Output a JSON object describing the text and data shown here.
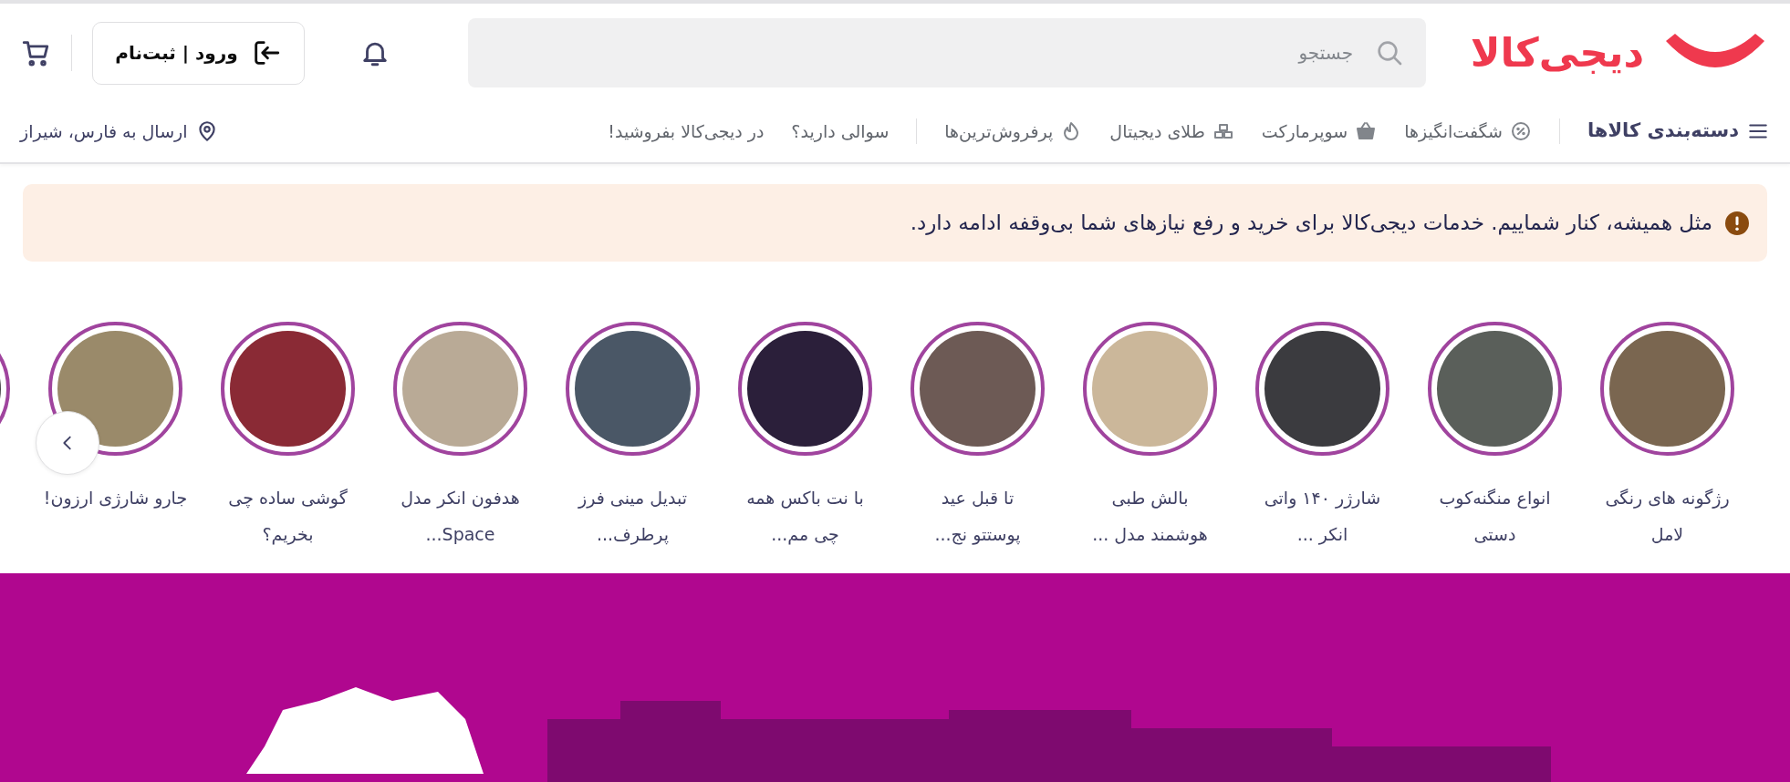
{
  "header": {
    "logo_text": "دیجی‌کالا",
    "search": {
      "placeholder": "جستجو"
    },
    "login_button": "ورود | ثبت‌نام"
  },
  "nav": {
    "categories": "دسته‌بندی کالاها",
    "items": [
      {
        "kind": "percent",
        "label": "شگفت‌انگیزها"
      },
      {
        "kind": "basket",
        "label": "سوپرمارکت"
      },
      {
        "kind": "gold",
        "label": "طلای دیجیتال"
      },
      {
        "kind": "flame",
        "label": "پرفروش‌ترین‌ها"
      }
    ],
    "links": [
      "سوالی دارید؟",
      "در دیجی‌کالا بفروشید!"
    ],
    "location": "ارسال به فارس، شیراز"
  },
  "alert": {
    "text": "مثل همیشه، کنار شماییم. خدمات دیجی‌کالا برای خرید و رفع نیازهای شما بی‌وقفه ادامه دارد."
  },
  "stories": {
    "items": [
      {
        "lines": [
          "رژگونه های رنگی",
          "لامل"
        ]
      },
      {
        "lines": [
          "انواع منگنه‌کوب",
          "دستی"
        ]
      },
      {
        "lines": [
          "شارژر ۱۴۰ واتی",
          "انکر ..."
        ]
      },
      {
        "lines": [
          "بالش طبی",
          "هوشمند مدل ..."
        ]
      },
      {
        "lines": [
          "تا قبل عید",
          "پوستتو نج..."
        ]
      },
      {
        "lines": [
          "با نت باکس همه",
          "چی مم..."
        ]
      },
      {
        "lines": [
          "تبدیل مینی فرز",
          "پرطرف..."
        ]
      },
      {
        "lines": [
          "هدفون انکر مدل",
          "Space..."
        ]
      },
      {
        "lines": [
          "گوشی ساده چی",
          "بخریم؟"
        ]
      },
      {
        "lines": [
          "جارو شارژی ارزون!"
        ]
      }
    ],
    "peek": true
  }
}
